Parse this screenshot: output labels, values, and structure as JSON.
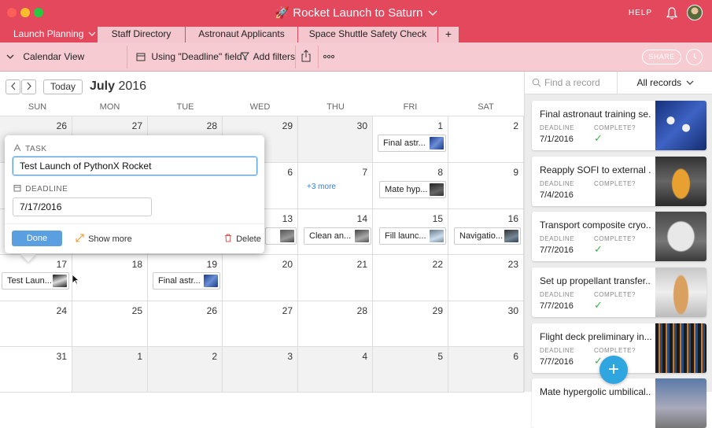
{
  "window": {
    "title": "Rocket Launch to Saturn",
    "help": "HELP"
  },
  "tabs": [
    {
      "label": "Launch Planning"
    },
    {
      "label": "Staff Directory"
    },
    {
      "label": "Astronaut Applicants"
    },
    {
      "label": "Space Shuttle Safety Check"
    },
    {
      "label": "+"
    }
  ],
  "toolbar": {
    "view": "Calendar View",
    "using": "Using \"Deadline\" field",
    "filter": "Add filters",
    "share": "SHARE"
  },
  "calendar": {
    "today": "Today",
    "month": "July",
    "year": "2016",
    "weekdays": [
      "SUN",
      "MON",
      "TUE",
      "WED",
      "THU",
      "FRI",
      "SAT"
    ],
    "days": [
      "26",
      "27",
      "28",
      "29",
      "30",
      "1",
      "2",
      "3",
      "4",
      "5",
      "6",
      "7",
      "8",
      "9",
      "10",
      "11",
      "12",
      "13",
      "14",
      "15",
      "16",
      "17",
      "18",
      "19",
      "20",
      "21",
      "22",
      "23",
      "24",
      "25",
      "26",
      "27",
      "28",
      "29",
      "30",
      "31",
      "1",
      "2",
      "3",
      "4",
      "5",
      "6"
    ],
    "more": "+3 more",
    "events": [
      {
        "label": "Final astr..."
      },
      {
        "label": "Mate hyp..."
      },
      {
        "label": "Clean an..."
      },
      {
        "label": "Fill launc..."
      },
      {
        "label": "Navigatio..."
      },
      {
        "label": "Test Laun..."
      },
      {
        "label": "Final astr..."
      }
    ]
  },
  "popup": {
    "task_label": "TASK",
    "task_value": "Test Launch of PythonX Rocket",
    "deadline_label": "DEADLINE",
    "deadline_value": "7/17/2016",
    "done": "Done",
    "show_more": "Show more",
    "delete": "Delete"
  },
  "sidebar": {
    "search_placeholder": "Find a record",
    "filter": "All records",
    "deadline_label": "DEADLINE",
    "complete_label": "COMPLETE?",
    "check": "✓",
    "records": [
      {
        "title": "Final astronaut training se...",
        "deadline": "7/1/2016"
      },
      {
        "title": "Reapply SOFI to external ...",
        "deadline": "7/4/2016"
      },
      {
        "title": "Transport composite cryo...",
        "deadline": "7/7/2016"
      },
      {
        "title": "Set up propellant transfer...",
        "deadline": "7/7/2016"
      },
      {
        "title": "Flight deck preliminary in...",
        "deadline": "7/7/2016"
      },
      {
        "title": "Mate hypergolic umbilical...",
        "deadline": ""
      }
    ]
  },
  "fab": "+",
  "colors": {
    "accent": "#e3485d",
    "toolbar": "#f6cbd1",
    "link": "#2d7fd6",
    "done": "#5aa0e0",
    "check": "#3bb548",
    "fab": "#2fa6e0"
  }
}
